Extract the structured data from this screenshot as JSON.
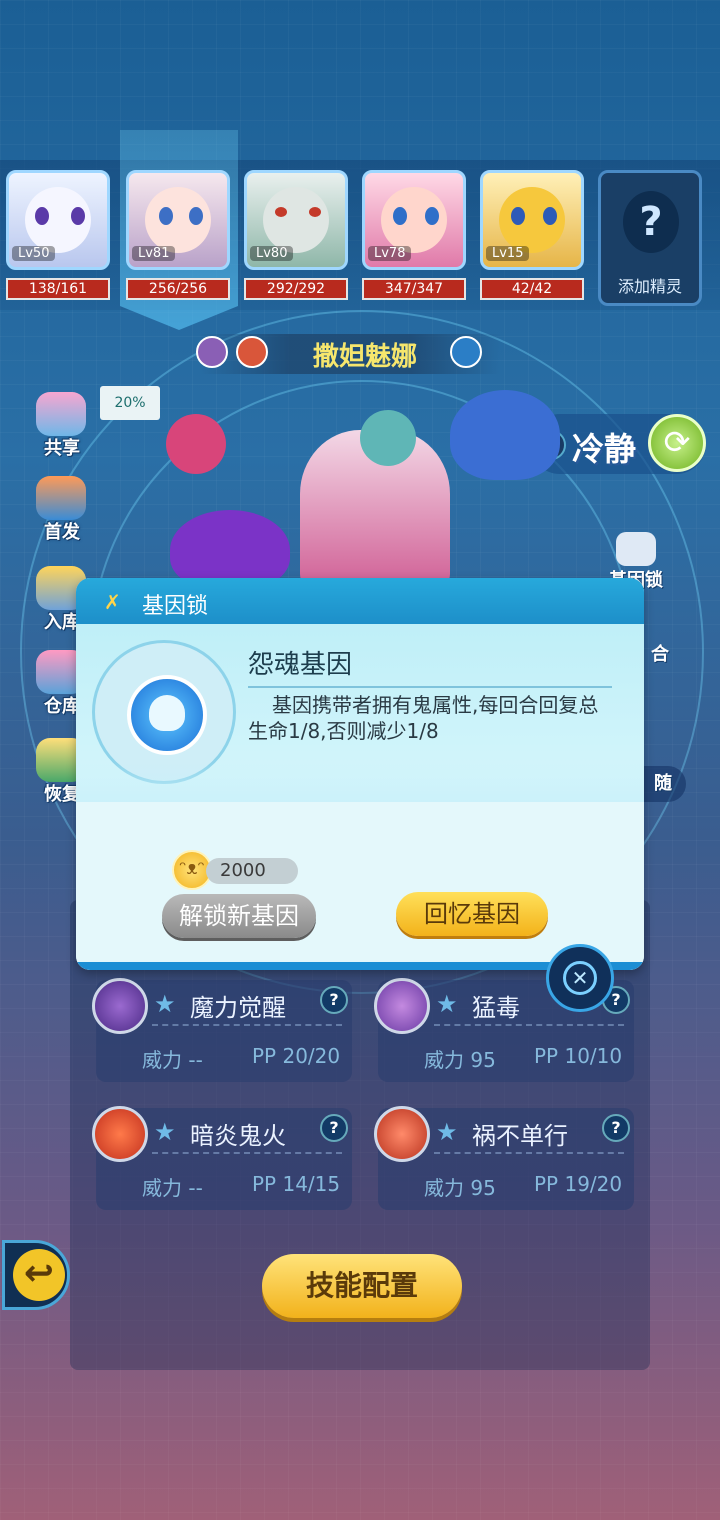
{
  "pets": [
    {
      "level": "Lv50",
      "hp": "138/161"
    },
    {
      "level": "Lv81",
      "hp": "256/256"
    },
    {
      "level": "Lv80",
      "hp": "292/292"
    },
    {
      "level": "Lv78",
      "hp": "347/347"
    },
    {
      "level": "Lv15",
      "hp": "42/42"
    }
  ],
  "add_pet": {
    "icon": "?",
    "label": "添加精灵"
  },
  "pet_name": "撒妲魅娜",
  "side_menu": {
    "share": "共享",
    "share_percent": "20%",
    "first": "首发",
    "storage_in": "入库",
    "warehouse": "仓库",
    "recover": "恢复"
  },
  "right_menu": {
    "temper": "冷静",
    "gene_lock": "基因锁",
    "combine": "合",
    "follow": "随"
  },
  "skills": [
    {
      "name": "魔力觉醒",
      "power": "威力 --",
      "pp": "PP 20/20"
    },
    {
      "name": "猛毒",
      "power": "威力 95",
      "pp": "PP 10/10"
    },
    {
      "name": "暗炎鬼火",
      "power": "威力 --",
      "pp": "PP 14/15"
    },
    {
      "name": "祸不单行",
      "power": "威力 95",
      "pp": "PP 19/20"
    }
  ],
  "skill_config_label": "技能配置",
  "dialog": {
    "title": "基因锁",
    "gene_name": "怨魂基因",
    "gene_desc": "基因携带者拥有鬼属性,每回合回复总生命1/8,否则减少1/8",
    "cost": "2000",
    "unlock_label": "解锁新基因",
    "recall_label": "回忆基因"
  },
  "colors": {
    "accent": "#1d8fc9",
    "hp_bar": "#b82a1e",
    "gold": "#f2b21b"
  }
}
